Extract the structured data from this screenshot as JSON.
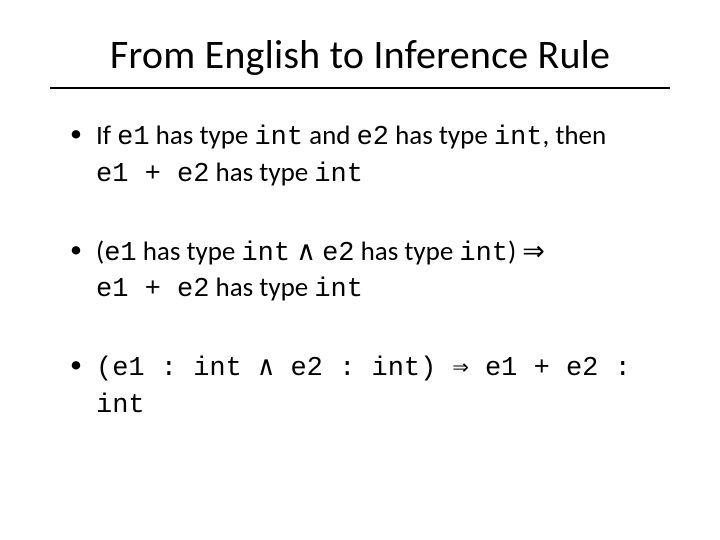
{
  "title": "From English to Inference Rule",
  "bullets": {
    "b1": {
      "t1": "If ",
      "e1": "e1",
      "t2": " has type ",
      "int1": "int",
      "t3": " and ",
      "e2": "e2",
      "t4": " has type ",
      "int2": "int",
      "t5": ", then ",
      "br": "",
      "e1p": "e1 + e2",
      "t6": " has type ",
      "int3": "int"
    },
    "b2": {
      "lp": "(",
      "e1": "e1",
      "t1": " has type ",
      "int1": "int",
      "and": " ∧ ",
      "e2": "e2",
      "t2": " has type ",
      "int2": "int",
      "rp": ")",
      "imp": " ⇒ ",
      "e1p": "e1 + e2",
      "t3": " has type ",
      "int3": "int"
    },
    "b3": {
      "full": "(e1 : int ∧ e2 : int) ⇒ e1 + e2 : int"
    }
  }
}
